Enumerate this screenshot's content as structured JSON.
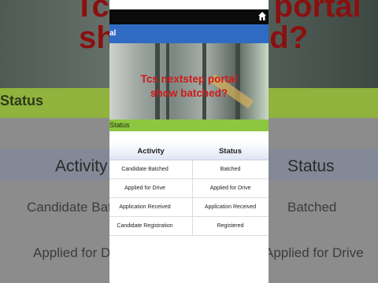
{
  "app": {
    "title": "al"
  },
  "overlay": {
    "line1": "Tcs nextstep portal",
    "line2": "show batched?"
  },
  "background_text": {
    "status": "Status",
    "activity": "Activity",
    "status_head": "Status",
    "cand_batch": "Candidate Batc",
    "batched": "Batched",
    "applied": "Applied for D",
    "applied_drive": "Applied for Drive",
    "red_top": "Tcs nextstep portal",
    "red_mid": "show batched?"
  },
  "section": {
    "label": "Status"
  },
  "table": {
    "headers": [
      "Activity",
      "Status"
    ],
    "rows": [
      {
        "activity": "Candidate Batched",
        "status": "Batched"
      },
      {
        "activity": "Applied for Drive",
        "status": "Applied for Drive"
      },
      {
        "activity": "Application Received",
        "status": "Application Received"
      },
      {
        "activity": "Candidate Registration",
        "status": "Registered"
      }
    ]
  },
  "colors": {
    "appbar": "#2f6bc3",
    "status_strip": "#8dc63f",
    "overlay_text": "#d11a1a"
  }
}
